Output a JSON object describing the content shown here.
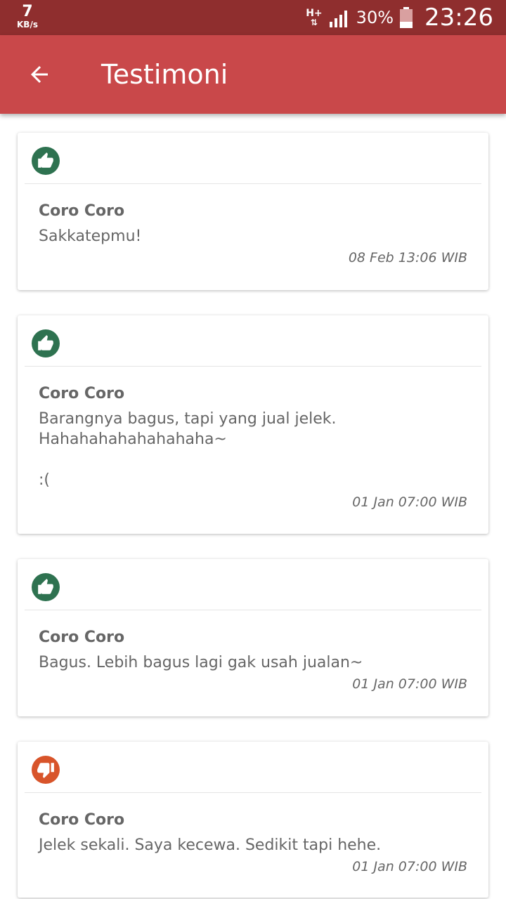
{
  "status_bar": {
    "net_speed_value": "7",
    "net_speed_unit": "KB/s",
    "network_type": "H+",
    "network_arrows": "⇅",
    "signal_icon": "signal-icon",
    "battery_percent": "30%",
    "battery_icon": "battery-icon",
    "time": "23:26"
  },
  "app_bar": {
    "back_icon": "arrow-left-icon",
    "title": "Testimoni"
  },
  "colors": {
    "status_bar": "#8f2e2e",
    "app_bar": "#c9484a",
    "positive": "#2e7250",
    "negative": "#d8542a",
    "text": "#666666"
  },
  "testimonials": [
    {
      "rating": "positive",
      "icon": "thumbs-up-icon",
      "author": "Coro Coro",
      "message": "Sakkatepmu!",
      "date": "08 Feb 13:06 WIB"
    },
    {
      "rating": "positive",
      "icon": "thumbs-up-icon",
      "author": "Coro Coro",
      "message": "Barangnya bagus, tapi yang jual jelek.\nHahahahahahahahaha~\n\n:(",
      "date": "01 Jan 07:00 WIB"
    },
    {
      "rating": "positive",
      "icon": "thumbs-up-icon",
      "author": "Coro Coro",
      "message": "Bagus. Lebih bagus lagi gak usah jualan~",
      "date": "01 Jan 07:00 WIB"
    },
    {
      "rating": "negative",
      "icon": "thumbs-down-icon",
      "author": "Coro Coro",
      "message": "Jelek sekali. Saya kecewa. Sedikit tapi hehe.",
      "date": "01 Jan 07:00 WIB"
    }
  ]
}
